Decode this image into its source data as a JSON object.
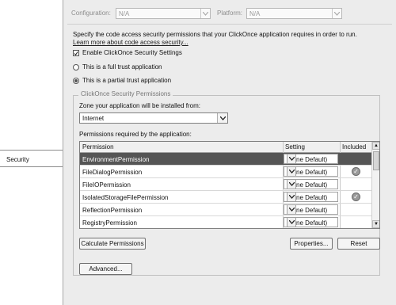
{
  "sidebar": {
    "selected_tab": "Security"
  },
  "top": {
    "configuration_label": "Configuration:",
    "configuration_value": "N/A",
    "platform_label": "Platform:",
    "platform_value": "N/A"
  },
  "description": "Specify the code access security permissions that your ClickOnce application requires in order to run.",
  "learn_more_link": "Learn more about code access security...",
  "enable_checkbox": {
    "label": "Enable ClickOnce Security Settings",
    "checked": true
  },
  "trust_options": [
    {
      "label": "This is a full trust application",
      "selected": false
    },
    {
      "label": "This is a partial trust application",
      "selected": true
    }
  ],
  "group_title": "ClickOnce Security Permissions",
  "zone_label": "Zone your application will be installed from:",
  "zone_value": "Internet",
  "permissions_label": "Permissions required by the application:",
  "grid": {
    "headers": {
      "permission": "Permission",
      "setting": "Setting",
      "included": "Included"
    },
    "rows": [
      {
        "permission": "EnvironmentPermission",
        "setting": "(Zone Default)",
        "included": false,
        "selected": true
      },
      {
        "permission": "FileDialogPermission",
        "setting": "(Zone Default)",
        "included": true,
        "selected": false
      },
      {
        "permission": "FileIOPermission",
        "setting": "(Zone Default)",
        "included": false,
        "selected": false
      },
      {
        "permission": "IsolatedStorageFilePermission",
        "setting": "(Zone Default)",
        "included": true,
        "selected": false
      },
      {
        "permission": "ReflectionPermission",
        "setting": "(Zone Default)",
        "included": false,
        "selected": false
      },
      {
        "permission": "RegistryPermission",
        "setting": "(Zone Default)",
        "included": false,
        "selected": false
      }
    ]
  },
  "buttons": {
    "calculate": "Calculate Permissions",
    "properties": "Properties...",
    "reset": "Reset",
    "advanced": "Advanced..."
  }
}
